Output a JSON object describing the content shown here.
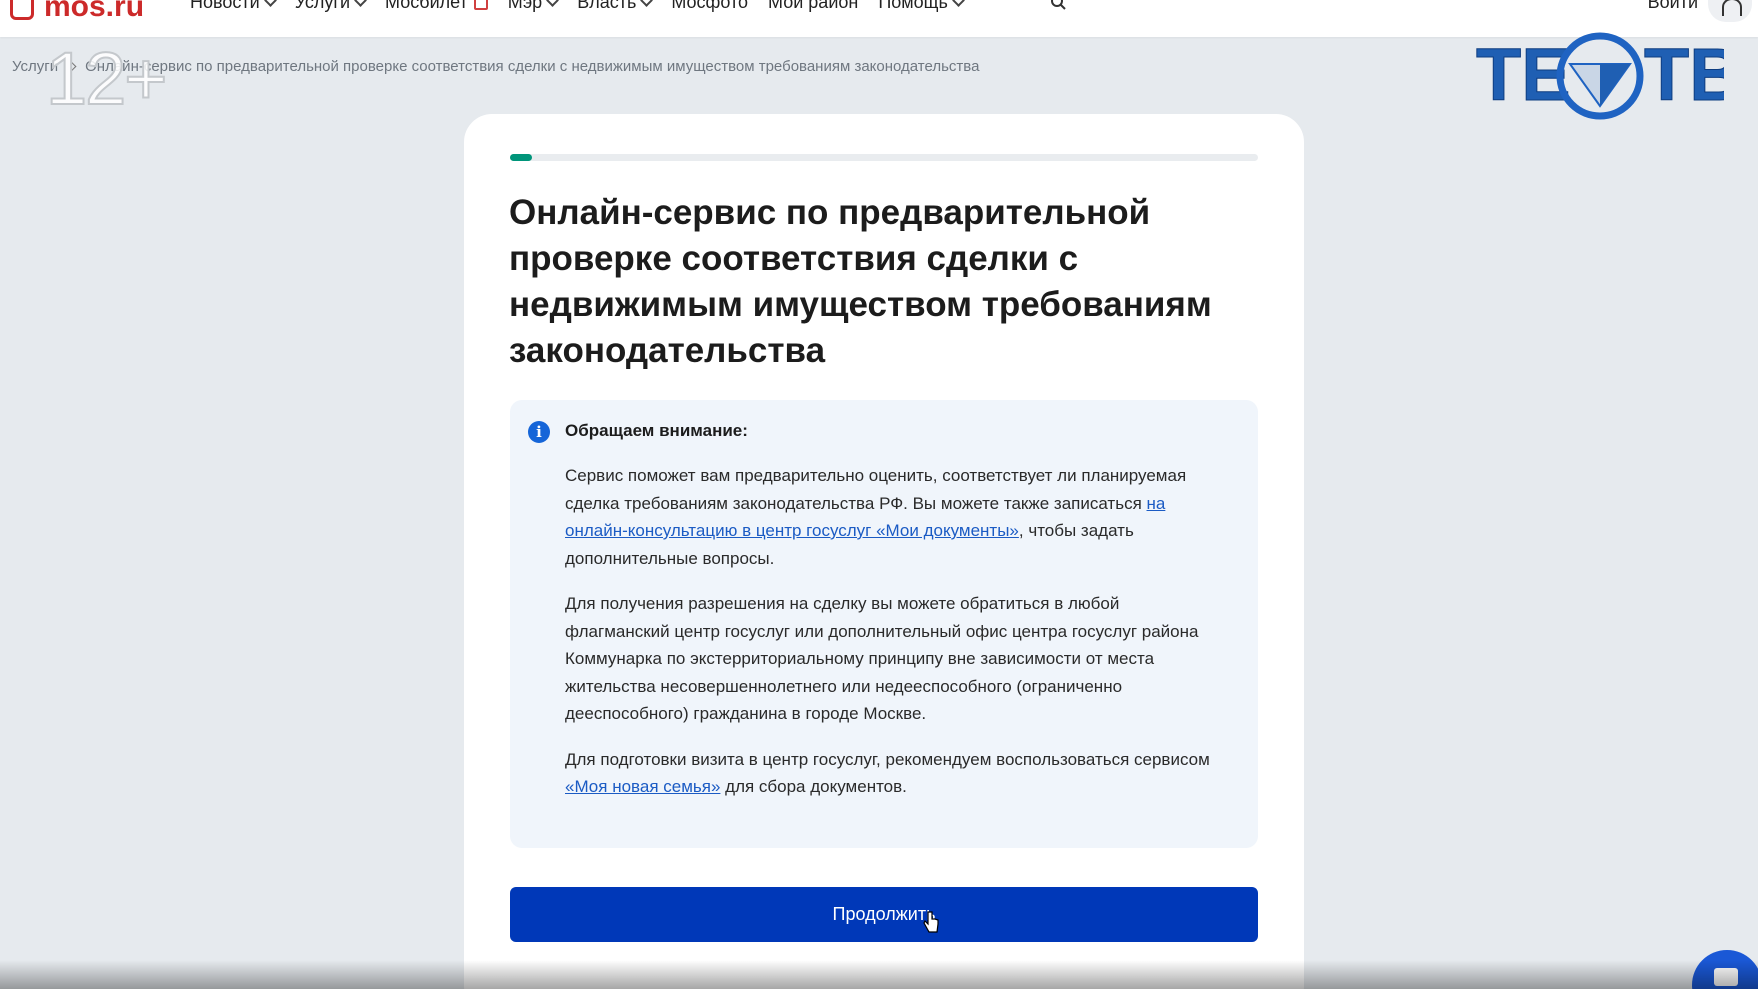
{
  "header": {
    "logo_text": "mos.ru",
    "nav": [
      {
        "label": "Новости",
        "has_dropdown": true
      },
      {
        "label": "Услуги",
        "has_dropdown": true
      },
      {
        "label": "Мосбилет",
        "has_dropdown": false
      },
      {
        "label": "Мэр",
        "has_dropdown": true
      },
      {
        "label": "Власть",
        "has_dropdown": true
      },
      {
        "label": "Мосфото",
        "has_dropdown": false
      },
      {
        "label": "Мой район",
        "has_dropdown": false
      },
      {
        "label": "Помощь",
        "has_dropdown": true
      }
    ],
    "login_label": "Войти"
  },
  "overlay": {
    "age_rating": "12+",
    "channel_logo": "ТЕОТВ"
  },
  "breadcrumb": {
    "items": [
      "Услуги",
      "Онлайн-сервис по предварительной проверке соответствия сделки с недвижимым имуществом требованиям законодательства"
    ]
  },
  "card": {
    "progress_fraction": 0.03,
    "title": "Онлайн-сервис по предварительной проверке соответствия сделки с недвижимым имуществом требованиям законодательства",
    "notice": {
      "heading": "Обращаем внимание:",
      "p1_before": "Сервис поможет вам предварительно оценить, соответствует ли планируемая сделка требованиям законодательства РФ. Вы можете также записаться ",
      "p1_link": "на онлайн-консультацию в центр госуслуг «Мои документы»",
      "p1_after": ", чтобы задать дополнительные вопросы.",
      "p2": "Для получения разрешения на сделку вы можете обратиться в любой флагманский центр госуслуг или дополнительный офис центра госуслуг района Коммунарка по экстерриториальному принципу вне зависимости от места жительства несовершеннолетнего или недееспособного (ограниченно дееспособного) гражданина в городе Москве.",
      "p3_before": "Для подготовки визита в центр госуслуг, рекомендуем воспользоваться сервисом ",
      "p3_link": "«Моя новая семья»",
      "p3_after": " для сбора документов."
    },
    "continue_label": "Продолжить"
  },
  "colors": {
    "brand_red": "#cc2a2a",
    "primary_button": "#0038b8",
    "progress": "#00957a",
    "link": "#1b5bc4",
    "notice_bg": "#f0f5fb"
  }
}
